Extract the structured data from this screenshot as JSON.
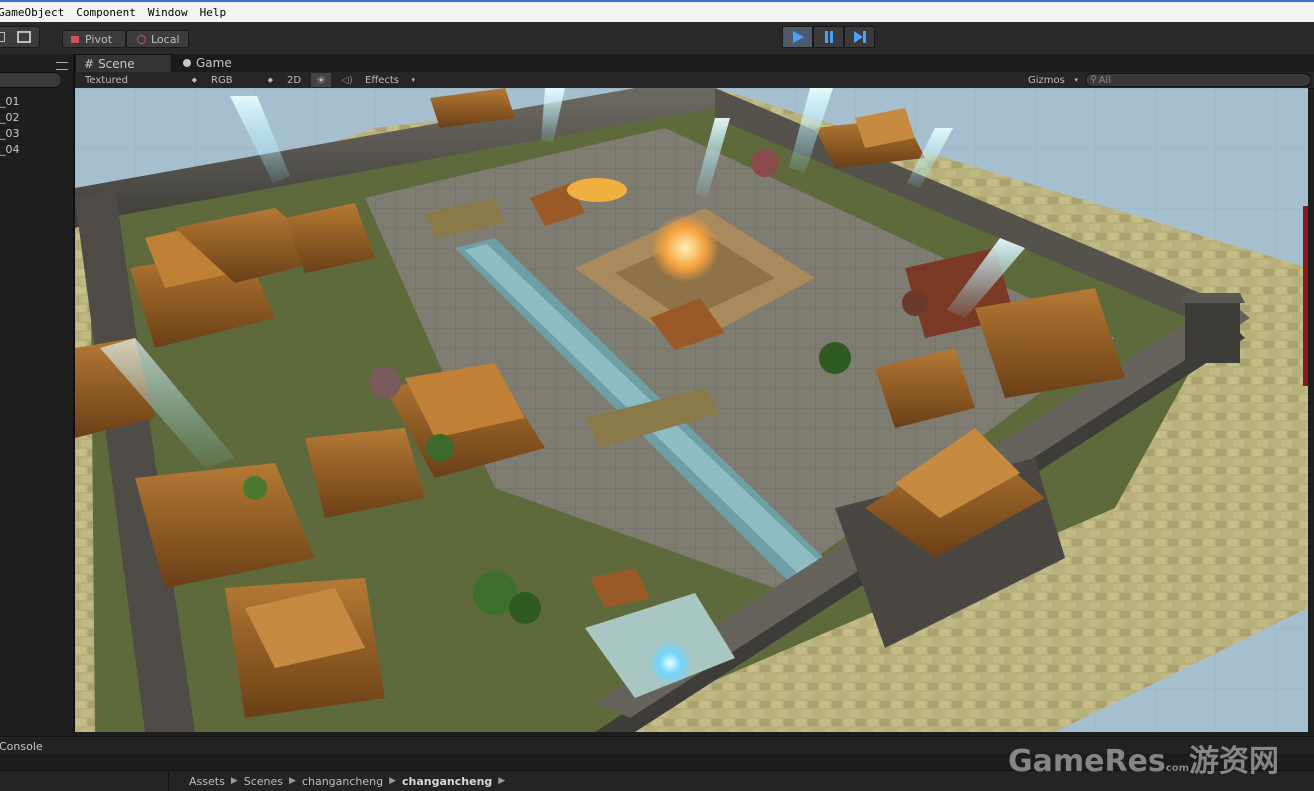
{
  "menu": {
    "items": [
      "GameObject",
      "Component",
      "Window",
      "Help"
    ]
  },
  "toolbar": {
    "pivot_label": "Pivot",
    "local_label": "Local"
  },
  "hierarchy": {
    "items": [
      "_01",
      "_02",
      "_03",
      "_04"
    ]
  },
  "tabs": {
    "scene_label": "Scene",
    "game_label": "Game"
  },
  "scene_header": {
    "render_mode": "Textured",
    "color_mode": "RGB",
    "mode_2d": "2D",
    "effects_label": "Effects",
    "gizmos_label": "Gizmos",
    "search_placeholder": "All"
  },
  "console": {
    "label": "Console"
  },
  "breadcrumb": {
    "items": [
      "Assets",
      "Scenes",
      "changancheng",
      "changancheng"
    ]
  },
  "watermark": {
    "text": "GameRes",
    "suffix": "com",
    "cn_text": "游资网"
  },
  "colors": {
    "accent": "#3b6fd0",
    "play_icon": "#4aa0ff"
  }
}
